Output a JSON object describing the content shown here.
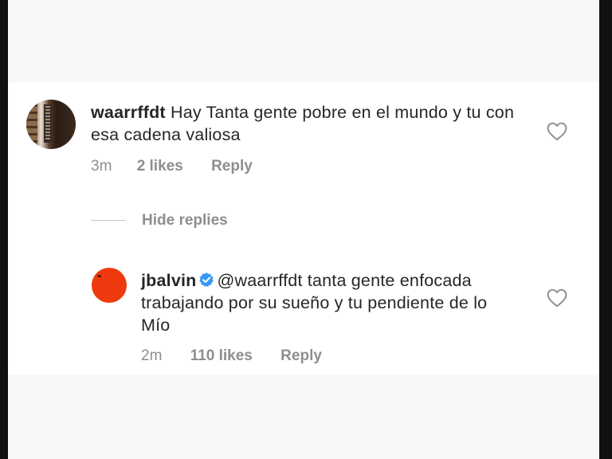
{
  "comment": {
    "username": "waarrffdt",
    "text": "Hay Tanta gente pobre en el mundo y tu con esa cadena valiosa",
    "time": "3m",
    "likes": "2 likes",
    "reply_label": "Reply",
    "avatar_icon": "bookshelf-photo"
  },
  "replies_toggle": {
    "label": "Hide replies"
  },
  "reply": {
    "username": "jbalvin",
    "verified": true,
    "mention": "@waarrffdt",
    "text": "tanta gente enfocada trabajando por su sueño y tu pendiente de lo Mío",
    "time": "2m",
    "likes": "110 likes",
    "reply_label": "Reply",
    "avatar_color": "#ee3a0e"
  },
  "colors": {
    "text": "#262626",
    "secondary": "#8e8e8e",
    "verified_blue": "#3897f0"
  }
}
